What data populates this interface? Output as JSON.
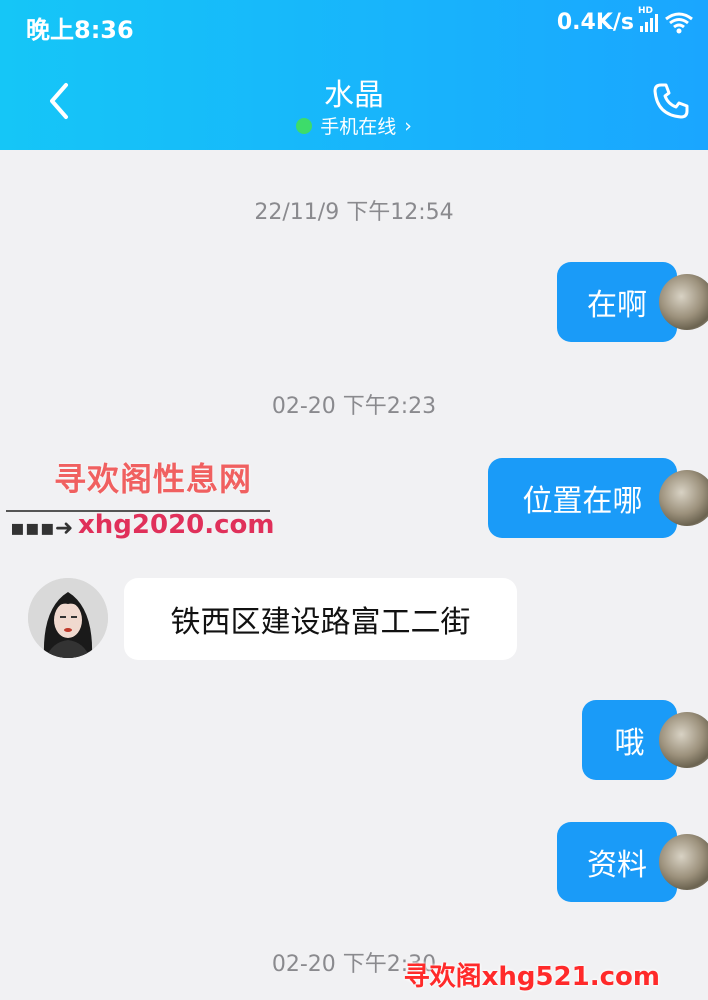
{
  "status_bar": {
    "time": "晚上8:36",
    "speed": "0.4K/s",
    "network_badge": "HD"
  },
  "header": {
    "back_icon": "chevron-left-icon",
    "title": "水晶",
    "subtitle": "手机在线",
    "subtitle_chevron": "›",
    "call_icon": "phone-icon",
    "colors": {
      "gradient_start": "#15c6f7",
      "gradient_end": "#1aa6ff",
      "online": "#3ddc6a"
    }
  },
  "messages": {
    "ts1": "22/11/9 下午12:54",
    "m1": "在啊",
    "ts2": "02-20 下午2:23",
    "m2": "位置在哪",
    "m3": "铁西区建设路富工二街",
    "m4": "哦",
    "m5": "资料",
    "ts3": "02-20 下午2:30",
    "colors": {
      "outgoing": "#1a9bf8",
      "incoming": "#ffffff"
    }
  },
  "watermark": {
    "line1": "寻欢阁性息网",
    "line2": "xhg2020.com",
    "corner": "寻欢阁xhg521.com"
  }
}
